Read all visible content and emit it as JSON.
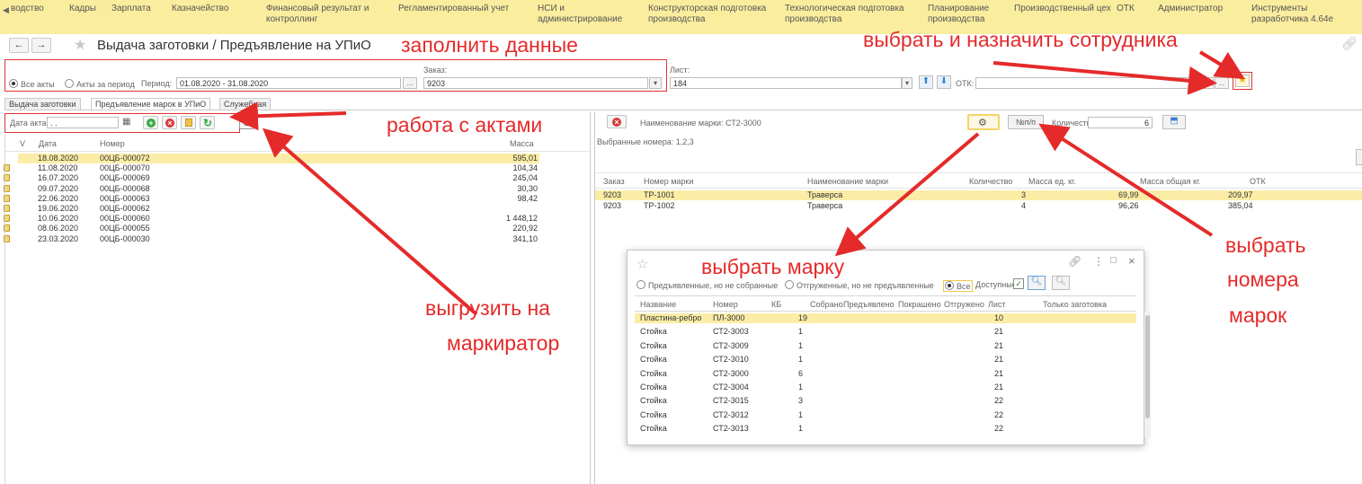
{
  "top_menu": [
    "водство",
    "Кадры",
    "Зарплата",
    "Казначейство",
    "Финансовый результат и контроллинг",
    "Регламентированный учет",
    "НСИ и администрирование",
    "Конструкторская подготовка производства",
    "Технологическая подготовка производства",
    "Планирование производства",
    "Производственный цех",
    "ОТК",
    "Администратор",
    "Инструменты разработчика 4.64е"
  ],
  "window_title": "Выдача заготовки / Предъявление на УПиО",
  "annotations": {
    "fill_data": "заполнить данные",
    "assign_employee": "выбрать и назначить сотрудника",
    "acts_work": "работа с актами",
    "export_marker_1": "выгрузить на",
    "export_marker_2": "маркиратор",
    "choose_mark": "выбрать марку",
    "choose_numbers_1": "выбрать",
    "choose_numbers_2": "номера",
    "choose_numbers_3": "марок"
  },
  "filters": {
    "all_acts": "Все акты",
    "acts_period": "Акты за период",
    "period_label": "Период:",
    "period_value": "01.08.2020 - 31.08.2020",
    "order_label": "Заказ:",
    "order_value": "9203",
    "sheet_label": "Лист:",
    "sheet_value": "184",
    "otk_label": "ОТК:",
    "otk_value": ""
  },
  "tabs": [
    "Выдача заготовки",
    "Предъявление марок в УПиО",
    "Служебная"
  ],
  "acts_toolbar": {
    "date_label": "Дата акта:",
    "date_value": " .  ."
  },
  "acts_table": {
    "columns": [
      "V",
      "Дата",
      "Номер",
      "Масса"
    ],
    "rows": [
      {
        "date": "18.08.2020",
        "number": "00ЦБ-000072",
        "mass": "595,01",
        "locked": false,
        "selected": true
      },
      {
        "date": "11.08.2020",
        "number": "00ЦБ-000070",
        "mass": "104,34",
        "locked": true,
        "selected": false
      },
      {
        "date": "16.07.2020",
        "number": "00ЦБ-000069",
        "mass": "245,04",
        "locked": true,
        "selected": false
      },
      {
        "date": "09.07.2020",
        "number": "00ЦБ-000068",
        "mass": "30,30",
        "locked": true,
        "selected": false
      },
      {
        "date": "22.06.2020",
        "number": "00ЦБ-000063",
        "mass": "98,42",
        "locked": true,
        "selected": false
      },
      {
        "date": "19.06.2020",
        "number": "00ЦБ-000062",
        "mass": "",
        "locked": true,
        "selected": false
      },
      {
        "date": "10.06.2020",
        "number": "00ЦБ-000060",
        "mass": "1 448,12",
        "locked": true,
        "selected": false
      },
      {
        "date": "08.06.2020",
        "number": "00ЦБ-000055",
        "mass": "220,92",
        "locked": true,
        "selected": false
      },
      {
        "date": "23.03.2020",
        "number": "00ЦБ-000030",
        "mass": "341,10",
        "locked": true,
        "selected": false
      }
    ]
  },
  "marks_panel": {
    "mark_name_label": "Наименование марки: СТ2-3000",
    "nn_button": "№п/п",
    "qty_label": "Количество:",
    "qty_value": "6",
    "selected_numbers": "Выбранные номера: 1,2,3"
  },
  "marks_table": {
    "columns": [
      "Заказ",
      "Номер марки",
      "Наименование марки",
      "Количество",
      "Масса ед. кг.",
      "Масса общая кг.",
      "ОТК"
    ],
    "rows": [
      {
        "order": "9203",
        "mark": "ТР-1001",
        "name": "Траверса",
        "qty": "3",
        "unit_mass": "69,99",
        "total_mass": "209,97",
        "selected": true
      },
      {
        "order": "9203",
        "mark": "ТР-1002",
        "name": "Траверса",
        "qty": "4",
        "unit_mass": "96,26",
        "total_mass": "385,04",
        "selected": false
      }
    ]
  },
  "dialog": {
    "opt_presented": "Предъявленные, но не собранные",
    "opt_shipped": "Отгруженные, но не предъявленные",
    "opt_all": "Все",
    "available_label": "Доступные:",
    "columns": [
      "Название",
      "Номер",
      "КБ",
      "Собрано",
      "Предъявлено",
      "Покрашено",
      "Отгружено",
      "Лист",
      "Только заготовка"
    ],
    "rows": [
      {
        "name": "Пластина-ребро",
        "number": "ПЛ-3000",
        "kb": "19",
        "sheet": "10",
        "selected": true
      },
      {
        "name": "Стойка",
        "number": "СТ2-3003",
        "kb": "1",
        "sheet": "21",
        "selected": false
      },
      {
        "name": "Стойка",
        "number": "СТ2-3009",
        "kb": "1",
        "sheet": "21",
        "selected": false
      },
      {
        "name": "Стойка",
        "number": "СТ2-3010",
        "kb": "1",
        "sheet": "21",
        "selected": false
      },
      {
        "name": "Стойка",
        "number": "СТ2-3000",
        "kb": "6",
        "sheet": "21",
        "selected": false
      },
      {
        "name": "Стойка",
        "number": "СТ2-3004",
        "kb": "1",
        "sheet": "21",
        "selected": false
      },
      {
        "name": "Стойка",
        "number": "СТ2-3015",
        "kb": "3",
        "sheet": "22",
        "selected": false
      },
      {
        "name": "Стойка",
        "number": "СТ2-3012",
        "kb": "1",
        "sheet": "22",
        "selected": false
      },
      {
        "name": "Стойка",
        "number": "СТ2-3013",
        "kb": "1",
        "sheet": "22",
        "selected": false
      }
    ]
  },
  "colors": {
    "menu_bg": "#fbed9e",
    "annotation": "#e52a2a",
    "selection": "#fbeda6"
  }
}
